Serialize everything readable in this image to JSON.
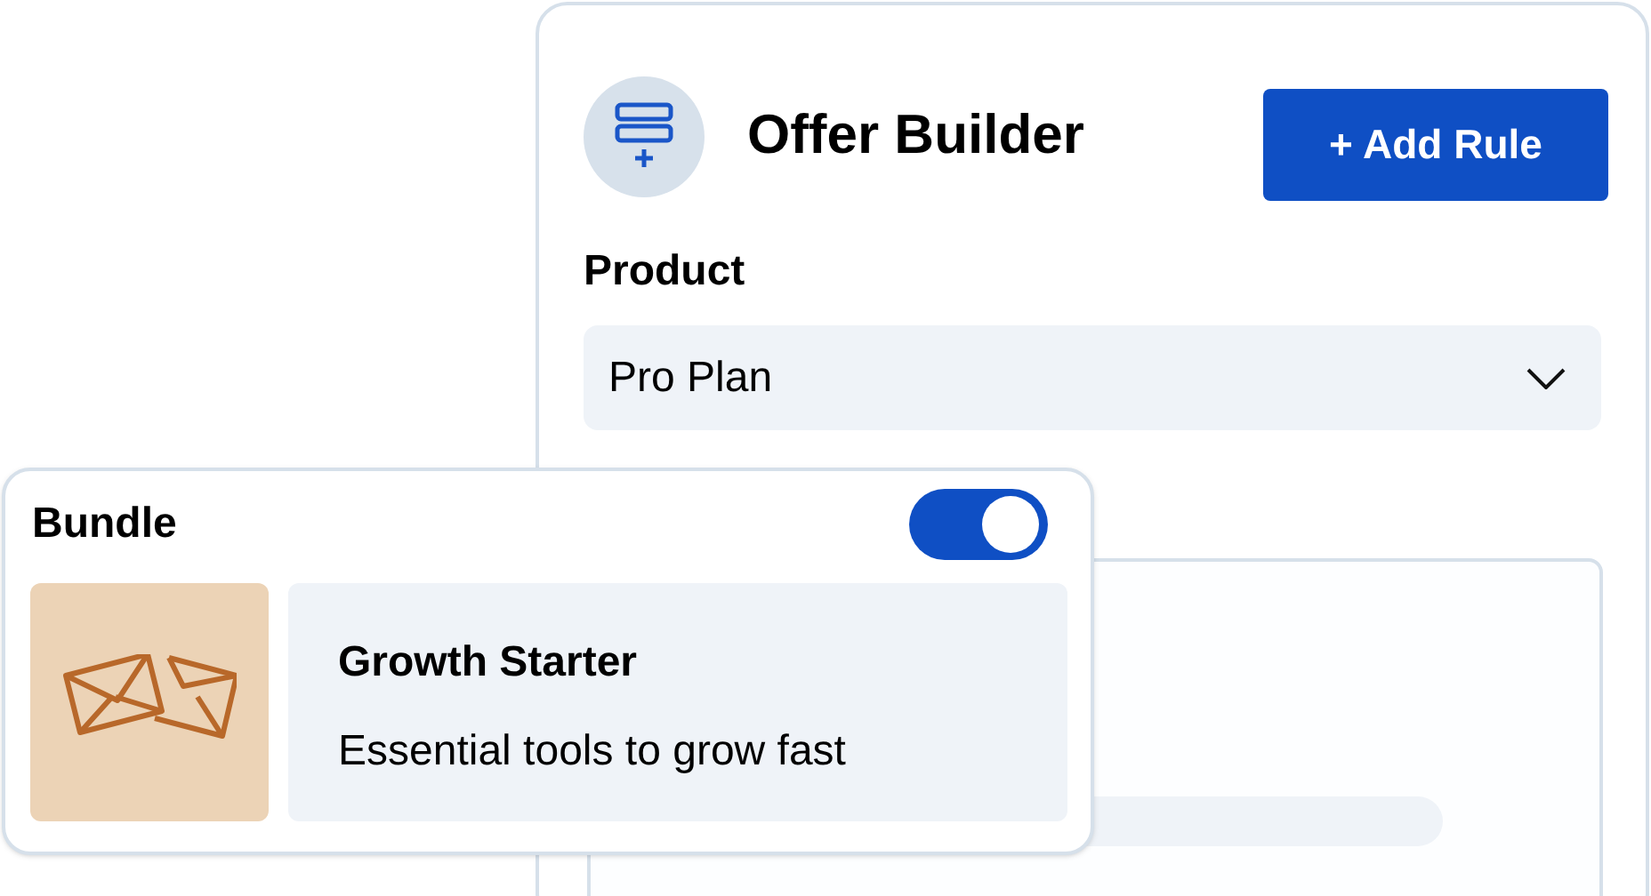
{
  "offer_builder": {
    "title": "Offer Builder",
    "add_button": "+ Add Rule",
    "product_label": "Product",
    "product_value": "Pro Plan"
  },
  "bundle": {
    "label": "Bundle",
    "toggle_on": true,
    "item": {
      "title": "Growth Starter",
      "description": "Essential tools to grow fast"
    }
  }
}
